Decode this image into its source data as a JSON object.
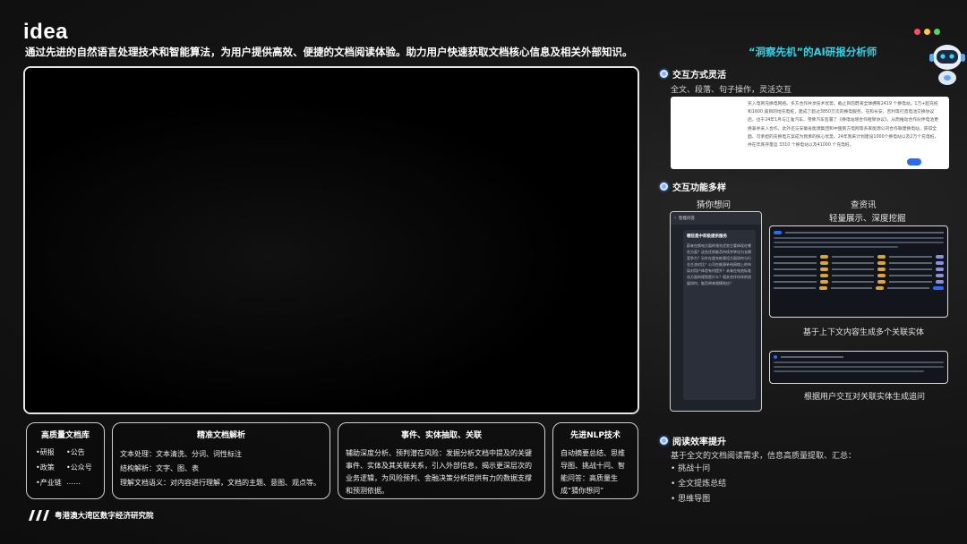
{
  "brand": {
    "logo": "idea"
  },
  "header": {
    "tagline": "通过先进的自然语言处理技术和智能算法，为用户提供高效、便捷的文档阅读体验。助力用户快速获取文档核心信息及相关外部知识。",
    "subtitle": "“洞察先机”的AI研报分析师"
  },
  "colors": {
    "accent_cyan": "#2fd4e8",
    "dot_red": "#ff4d5e",
    "dot_yellow": "#ffc83d",
    "dot_green": "#4cd964",
    "bullet_blue": "#7fb6ff"
  },
  "features": {
    "library": {
      "title": "高质量文档库",
      "items": [
        "•研报",
        "•公告",
        "•政策",
        "•公众号",
        "•产业链",
        "……"
      ]
    },
    "parsing": {
      "title": "精准文档解析",
      "lines": [
        "文本处理：文本清洗、分词、词性标注",
        "结构解析：文字、图、表",
        "理解文档语义：对内容进行理解，文档的主题、意图、观点等。"
      ]
    },
    "events": {
      "title": "事件、实体抽取、关联",
      "text": "辅助深度分析、预判潜在风险：发掘分析文档中提及的关键事件、实体及其关联关系，引入外部信息，揭示更深层次的业务逻辑，为风险预判、金融决策分析提供有力的数据支撑和预测依据。"
    },
    "nlp": {
      "title": "先进NLP技术",
      "text": "自动摘要总结、思维导图、挑战十问、智能问答：高质量生成“猜你想问”"
    }
  },
  "interaction": {
    "title": "交互方式灵活",
    "subtitle": "全文、段落、句子操作，灵活交互",
    "doc_text": "买入电商充换电网络。多方合作共享技术优势。截止目前蔚来全球拥有2419 个换电站，1万+超充桩和1600 座目的地充电桩，建成了超过3850万次的换电服务。在和长安、吉利等打造电池交换协议后，也于24年1月与江淮汽车、雪佛汽车签署了《换电站增合作框架协议》，从而推动合作伙伴电池更换兼并采入合作，此外还与安徽省能源集团和中国南方电网等多家能源公司合作联建换电站，获得全面、可承担的充换电方案成为我承的核心优势。24年我来计划建设1000个换电站以及2万个充电桩，并在年底存量运 3310 个换电站以及41000 个充电桩。"
  },
  "diverse": {
    "title": "交互功能多样",
    "guess": {
      "title": "猜你想问"
    },
    "lookup": {
      "title": "查资讯",
      "subtitle": "轻量展示、深度挖掘"
    },
    "phone": {
      "app_title": "智能问答",
      "heading": "哪些是中积极提供服务",
      "body": "蔚来在换电方面的领先优势主要体现在哪些方面？这些优势能否持续并转化为长期竞争力？另外在超充桩建设方面如何与行业主流对比？公司在能源补给网络上的布局对用户体验有何提升？未来在电池标准化方面的规划是什么？相关合作伙伴的进展如何，能否带来规模效应？"
    },
    "caption_entities": "基于上下文内容生成多个关联实体",
    "caption_followup": "根据用户交互对关联实体生成追问"
  },
  "efficiency": {
    "title": "阅读效率提升",
    "subtitle": "基于全文的文档阅读需求，信息高质量提取、汇总：",
    "items": [
      "• 挑战十问",
      "• 全文提炼总结",
      "• 思维导图"
    ]
  },
  "footer": {
    "org": "粤港澳大湾区数字经济研究院"
  }
}
